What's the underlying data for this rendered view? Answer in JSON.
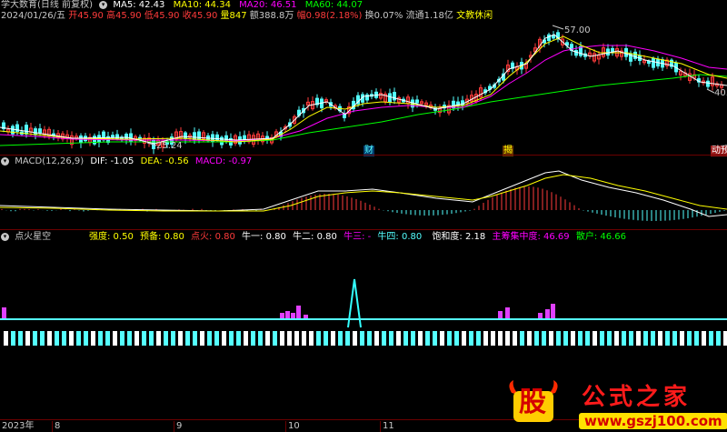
{
  "price_panel": {
    "title": "学大数育(日线 前复权)",
    "ma5": "MA5: 42.43",
    "ma10": "MA10: 44.34",
    "ma20": "MA20: 46.51",
    "ma60": "MA60: 44.07",
    "date": "2024/01/26/五",
    "open": "开45.90",
    "high": "高45.90",
    "low": "低45.90",
    "close": "收45.90",
    "volume": "量847",
    "amount": "额388.8万",
    "change": "幅0.98(2.18%)",
    "turnover": "换0.07%",
    "float": "流通1.18亿",
    "concept": "文教休闲",
    "peak_label": "57.00",
    "trough_label": "25.24",
    "right_label": "40.",
    "marker_cai": "财",
    "marker_mid": "揭",
    "marker_right": "动预"
  },
  "macd_panel": {
    "title": "MACD(12,26,9)",
    "dif": "DIF: -1.05",
    "dea": "DEA: -0.56",
    "macd": "MACD: -0.97"
  },
  "indicator_panel": {
    "title": "点火星空",
    "strength": "强度: 0.50",
    "prepare": "预备: 0.80",
    "ignite": "点火: 0.80",
    "bull1": "牛一: 0.80",
    "bull2": "牛二: 0.80",
    "bull3": "牛三: -",
    "bull4": "牛四: 0.80",
    "saturation": "饱和度: 2.18",
    "main_conc": "主筹集中度: 46.69",
    "retail": "散户: 46.66"
  },
  "xaxis": {
    "y2023": "2023年",
    "m8": "8",
    "m9": "9",
    "m10": "10",
    "m11": "11"
  },
  "watermark": {
    "gu": "股",
    "name": "公式之家",
    "url": "www.gszj100.com"
  },
  "colors": {
    "up": "#ff3b3b",
    "down": "#54ffff",
    "ma5": "#ffffff",
    "ma10": "#ffff00",
    "ma20": "#ff00ff",
    "ma60": "#00ff00"
  }
}
